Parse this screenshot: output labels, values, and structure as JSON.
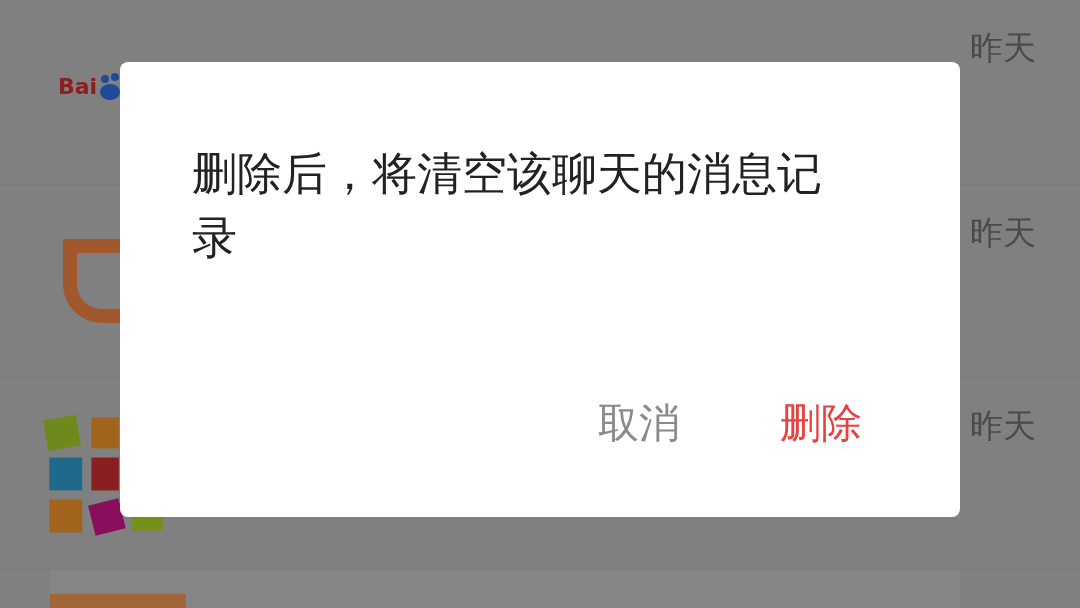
{
  "chat_list": [
    {
      "kind": "baidu",
      "logo_text": "Bai",
      "time": "昨天"
    },
    {
      "kind": "ring",
      "time": "昨天"
    },
    {
      "kind": "tiles",
      "time": "昨天"
    },
    {
      "kind": "thumb"
    }
  ],
  "dialog": {
    "message": "删除后，将清空该聊天的消息记录",
    "buttons": [
      {
        "label": "取消",
        "kind": "cancel"
      },
      {
        "label": "删除",
        "kind": "danger"
      }
    ]
  }
}
